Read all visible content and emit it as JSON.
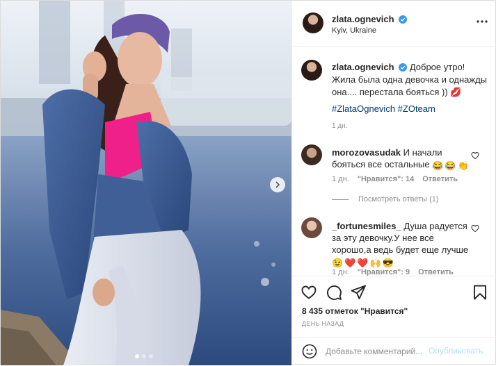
{
  "post": {
    "author": "zlata.ognevich",
    "location": "Kyiv, Ukraine",
    "verified_icon": "verified-badge-icon",
    "more_icon": "more-options-icon"
  },
  "caption": {
    "username": "zlata.ognevich",
    "text": "Доброе утро! Жила была одна девочка и однажды она.... перестала бояться ))",
    "emoji": "💋",
    "hashtags": "#ZlataOgnevich #ZOteam",
    "time": "1 дн."
  },
  "comments": [
    {
      "username": "morozovasudak",
      "text": "И начали бояться все остальные",
      "emoji": [
        "😂",
        "😂",
        "👏"
      ],
      "time": "1 дн.",
      "likes": "\"Нравится\": 14",
      "reply": "Ответить",
      "view_replies": "Посмотреть ответы (1)"
    },
    {
      "username": "_fortunesmiles_",
      "text": "Душа радуется за эту девочку.У нее все хорошо,а ведь будет еще лучше",
      "emoji": [
        "😉",
        "❤️",
        "❤️",
        "🙌",
        "😎"
      ],
      "time": "1 дн.",
      "likes": "\"Нравится\": 9",
      "reply": "Ответить"
    }
  ],
  "actions": {
    "likes_count": "8 435 отметок \"Нравится\"",
    "posted": "ДЕНЬ НАЗАД"
  },
  "comment_box": {
    "placeholder": "Добавьте комментарий...",
    "post_label": "Опубликовать"
  },
  "carousel": {
    "slides": 3,
    "active": 1
  },
  "colors": {
    "accent": "#0095f6",
    "post_disabled": "#b2dffc",
    "muted": "#8e8e8e",
    "hashtag": "#00376b",
    "verified": "#3897f0"
  }
}
